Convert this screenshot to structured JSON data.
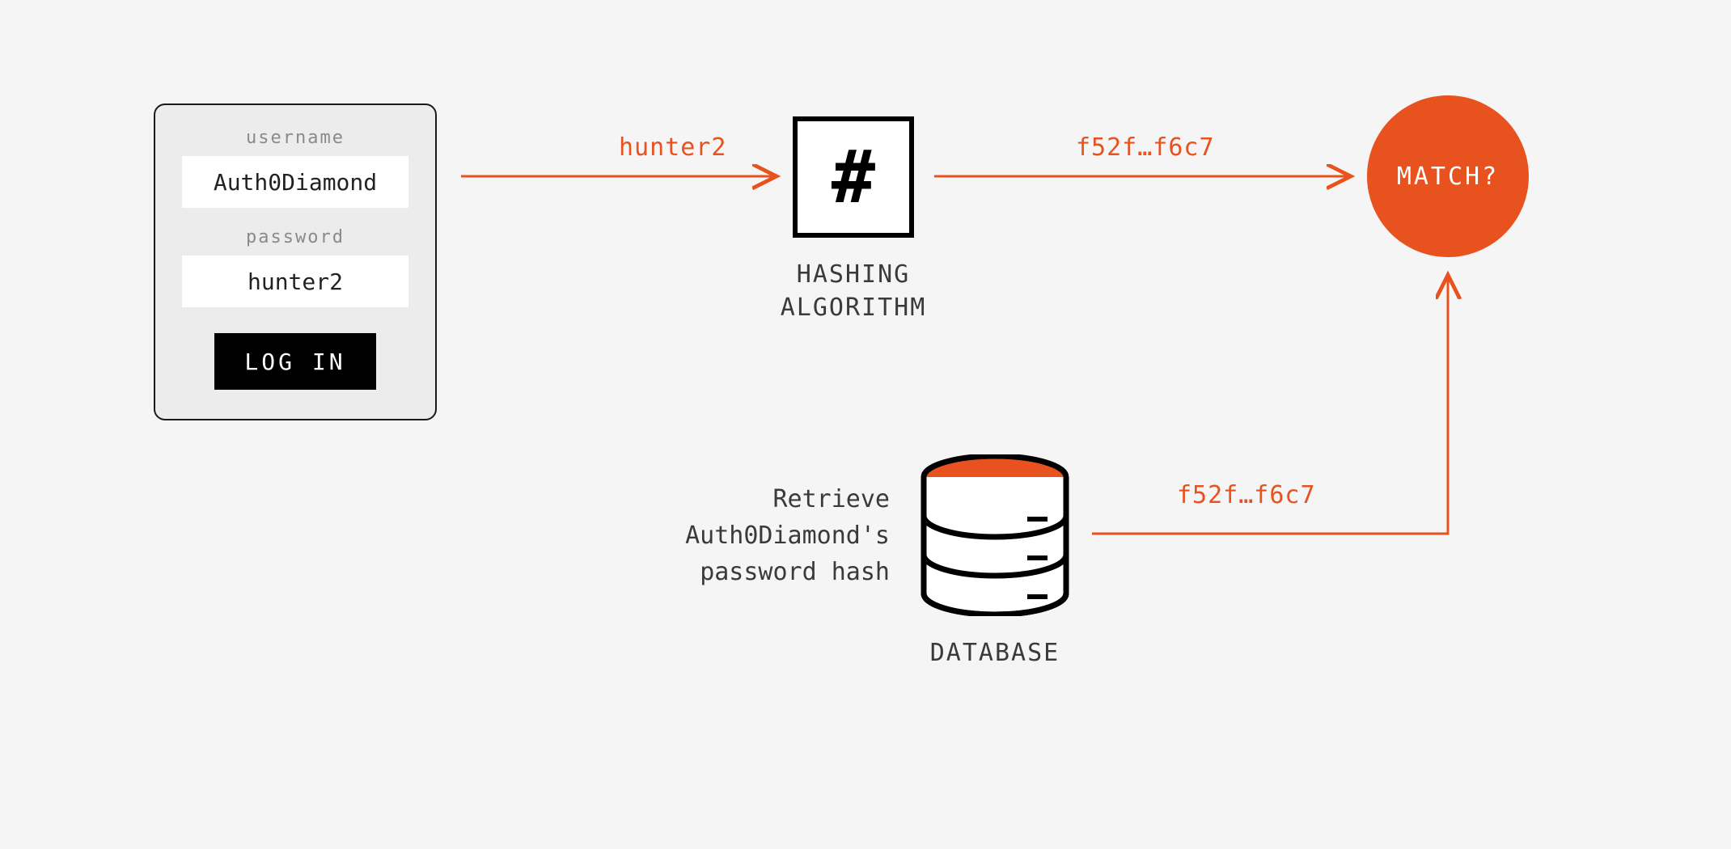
{
  "login": {
    "username_label": "username",
    "username_value": "Auth0Diamond",
    "password_label": "password",
    "password_value": "hunter2",
    "button_label": "LOG IN"
  },
  "flow": {
    "password_to_hash_label": "hunter2",
    "hash_output_label": "f52f…f6c7",
    "db_hash_label": "f52f…f6c7"
  },
  "hash": {
    "symbol": "#",
    "caption": "HASHING\nALGORITHM"
  },
  "match": {
    "text": "MATCH?"
  },
  "database": {
    "retrieve_text": "Retrieve Auth0Diamond's password hash",
    "caption": "DATABASE"
  },
  "colors": {
    "accent": "#e8521f",
    "text": "#3a3a3a"
  }
}
